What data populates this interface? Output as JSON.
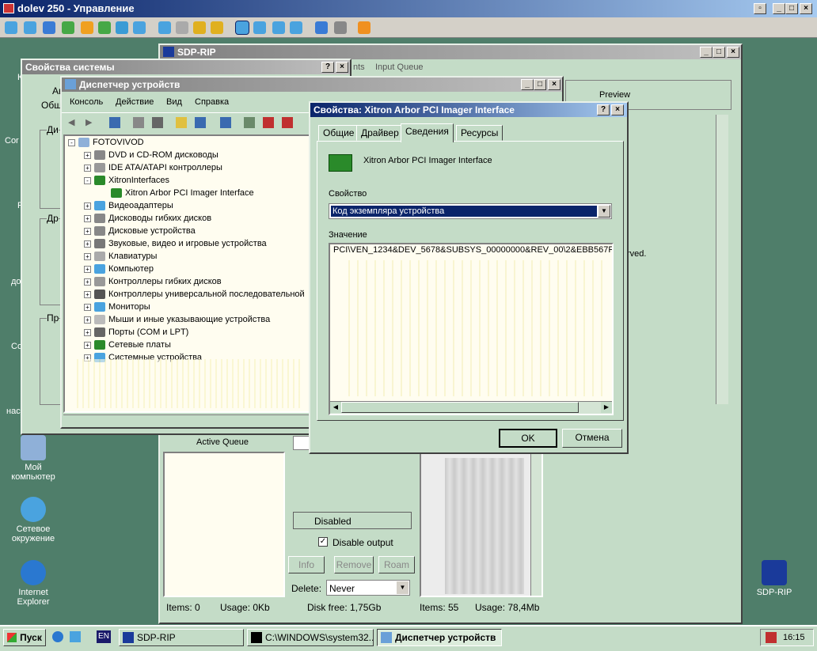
{
  "outer": {
    "title": "dolev 250 - Управление"
  },
  "desktop": {
    "icons": [
      {
        "label": "Мой компьютер"
      },
      {
        "label": "Сетевое окружение"
      },
      {
        "label": "Internet Explorer"
      },
      {
        "label": "SDP-RIP"
      }
    ],
    "partial": [
      "К",
      "Cor",
      "R",
      "до",
      "Co",
      "нас"
    ]
  },
  "sdprip": {
    "title": "SDP-RIP",
    "tab_partial": "nts",
    "tab_input": "Input Queue",
    "preview": "Preview",
    "reserved": "rved.",
    "active_queue": "Active Queue",
    "disabled": "Disabled",
    "disable_output": "Disable output",
    "info": "Info",
    "remove": "Remove",
    "roam": "Roam",
    "delete_label": "Delete:",
    "delete_value": "Never",
    "left_items": "Items: 0",
    "left_usage": "Usage: 0Kb",
    "disk_free": "Disk free: 1,75Gb",
    "right_items": "Items: 55",
    "right_usage": "Usage: 78,4Mb"
  },
  "sysprops": {
    "title": "Свойства системы",
    "tab1": "Ав",
    "tab2": "Общ",
    "g1": "Ди",
    "g2": "Др",
    "g3": "Пр"
  },
  "devmgr": {
    "title": "Диспетчер устройств",
    "menu": [
      "Консоль",
      "Действие",
      "Вид",
      "Справка"
    ],
    "root": "FOTOVIVOD",
    "items": [
      {
        "label": "DVD и CD-ROM дисководы",
        "exp": "+"
      },
      {
        "label": "IDE ATA/ATAPI контроллеры",
        "exp": "+"
      },
      {
        "label": "XitronInterfaces",
        "exp": "-"
      },
      {
        "label": "Xitron Arbor PCI Imager Interface",
        "exp": ""
      },
      {
        "label": "Видеоадаптеры",
        "exp": "+"
      },
      {
        "label": "Дисководы гибких дисков",
        "exp": "+"
      },
      {
        "label": "Дисковые устройства",
        "exp": "+"
      },
      {
        "label": "Звуковые, видео и игровые устройства",
        "exp": "+"
      },
      {
        "label": "Клавиатуры",
        "exp": "+"
      },
      {
        "label": "Компьютер",
        "exp": "+"
      },
      {
        "label": "Контроллеры гибких дисков",
        "exp": "+"
      },
      {
        "label": "Контроллеры универсальной последовательной",
        "exp": "+"
      },
      {
        "label": "Мониторы",
        "exp": "+"
      },
      {
        "label": "Мыши и иные указывающие устройства",
        "exp": "+"
      },
      {
        "label": "Порты (COM и LPT)",
        "exp": "+"
      },
      {
        "label": "Сетевые платы",
        "exp": "+"
      },
      {
        "label": "Системные устройства",
        "exp": "+"
      }
    ]
  },
  "props": {
    "title": "Свойства: Xitron Arbor PCI Imager Interface",
    "tabs": [
      "Общие",
      "Драйвер",
      "Сведения",
      "Ресурсы"
    ],
    "device": "Xitron Arbor PCI Imager Interface",
    "property_label": "Свойство",
    "property_value": "Код экземпляра устройства",
    "value_label": "Значение",
    "value_text": "PCI\\VEN_1234&DEV_5678&SUBSYS_00000000&REV_00\\2&EBB567F&",
    "ok": "OK",
    "cancel": "Отмена"
  },
  "taskbar": {
    "start": "Пуск",
    "lang": "EN",
    "tasks": [
      "SDP-RIP",
      "C:\\WINDOWS\\system32...",
      "Диспетчер устройств"
    ],
    "clock": "16:15"
  }
}
